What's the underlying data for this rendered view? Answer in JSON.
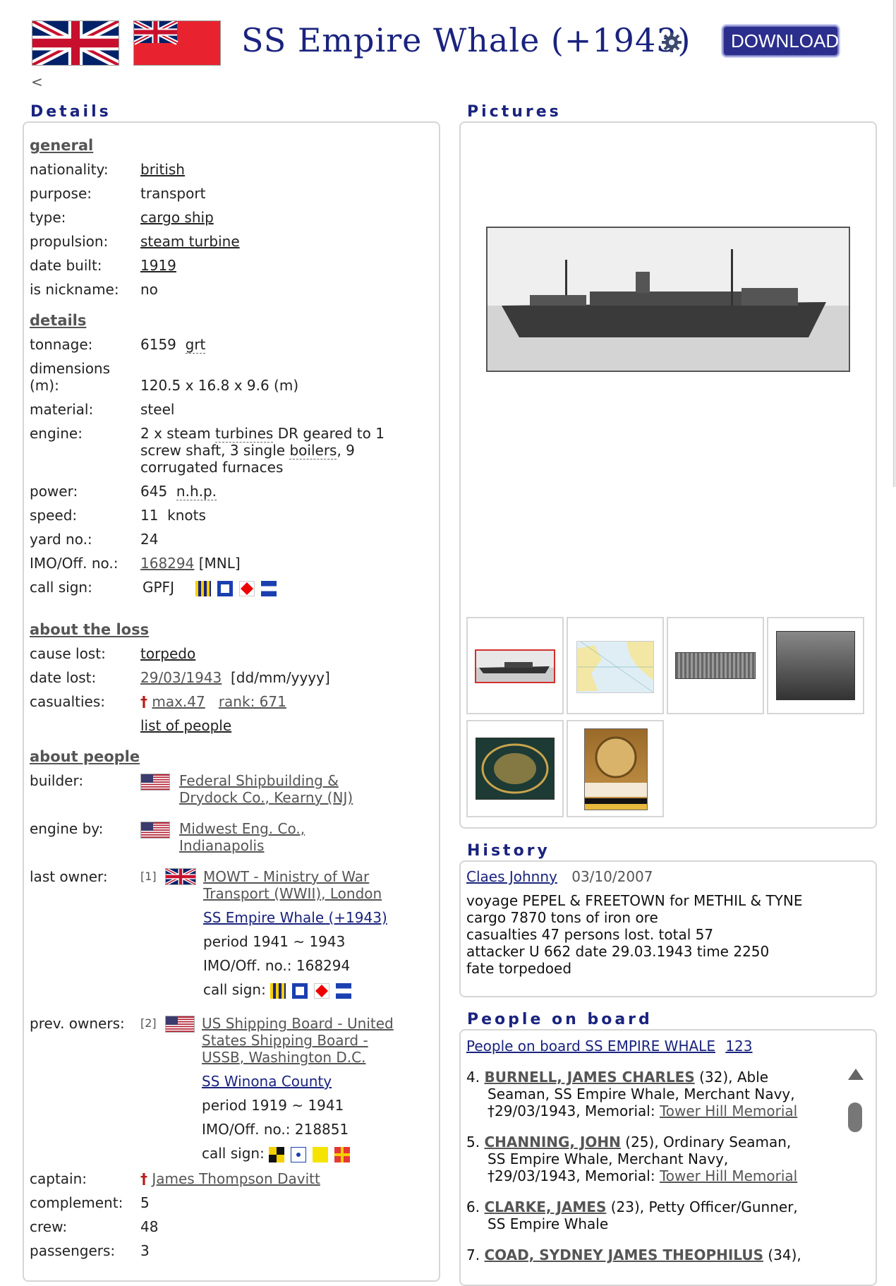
{
  "header": {
    "title": "SS Empire Whale (+1943)",
    "download_label": "DOWNLOAD",
    "back_label": "<"
  },
  "details": {
    "heading": "Details",
    "general": {
      "heading": "general",
      "nationality_label": "nationality:",
      "nationality": "british",
      "purpose_label": "purpose:",
      "purpose": "transport",
      "type_label": "type:",
      "type": "cargo ship",
      "propulsion_label": "propulsion:",
      "propulsion": "steam turbine",
      "date_built_label": "date built:",
      "date_built": "1919",
      "nickname_label": "is nickname:",
      "nickname": "no"
    },
    "specs": {
      "heading": "details",
      "tonnage_label": "tonnage:",
      "tonnage": "6159",
      "tonnage_unit": "grt",
      "dimensions_label_1": "dimensions",
      "dimensions_label_2": "(m):",
      "dimensions": "120.5 x 16.8 x 9.6 (m)",
      "material_label": "material:",
      "material": "steel",
      "engine_label": "engine:",
      "engine_1a": "2 x steam ",
      "engine_1b": "turbines",
      "engine_1c": " DR geared to 1",
      "engine_2a": "screw shaft, 3 single ",
      "engine_2b": "boilers",
      "engine_2c": ", 9",
      "engine_3": "corrugated furnaces",
      "power_label": "power:",
      "power": "645",
      "power_unit": "n.h.p.",
      "speed_label": "speed:",
      "speed": "11",
      "speed_unit": "knots",
      "yard_label": "yard no.:",
      "yard": "24",
      "imo_label": "IMO/Off. no.:",
      "imo": "168294",
      "imo_suffix": "[MNL]",
      "callsign_label": "call sign:",
      "callsign": "GPFJ"
    },
    "loss": {
      "heading": "about the loss",
      "cause_label": "cause lost:",
      "cause": "torpedo",
      "date_label": "date lost:",
      "date_day": "29/03/",
      "date_year": "1943",
      "date_format": "[dd/mm/yyyy]",
      "casualties_label": "casualties:",
      "casualties_max": "max.47",
      "casualties_rank": "rank: 671",
      "people_list": "list of people"
    },
    "people": {
      "heading": "about people",
      "builder_label": "builder:",
      "builder_1": "Federal Shipbuilding &",
      "builder_2a": "Drydock Co.",
      "builder_2b": "Kearny (NJ)",
      "engine_by_label": "engine by:",
      "engine_by_1": "Midwest Eng. Co.,",
      "engine_by_2": "Indianapolis",
      "last_owner_label": "last owner:",
      "last_owner_count": "[1]",
      "last_owner_1": "MOWT - Ministry of War",
      "last_owner_2a": "Transport (WWII)",
      "last_owner_2b": "London",
      "last_owner_ship": "SS Empire Whale (+1943)",
      "last_owner_period": "period 1941 ~ 1943",
      "last_owner_imo": "IMO/Off. no.: 168294",
      "last_owner_callsign": "call sign:",
      "prev_owners_label": "prev. owners:",
      "prev_owners_count": "[2]",
      "prev_owner_1": "US Shipping Board - United",
      "prev_owner_2": "States Shipping Board -",
      "prev_owner_3a": "USSB",
      "prev_owner_3b": "Washington D.C.",
      "prev_owner_ship": "SS Winona County",
      "prev_owner_period": "period 1919 ~ 1941",
      "prev_owner_imo": "IMO/Off. no.: 218851",
      "prev_owner_callsign": "call sign:",
      "captain_label": "captain:",
      "captain": "James Thompson Davitt",
      "complement_label": "complement:",
      "complement": "5",
      "crew_label": "crew:",
      "crew": "48",
      "passengers_label": "passengers:",
      "passengers": "3"
    }
  },
  "pictures": {
    "heading": "Pictures"
  },
  "history": {
    "heading": "History",
    "author": "Claes Johnny",
    "date": "03/10/2007",
    "lines": [
      "voyage PEPEL & FREETOWN for METHIL & TYNE",
      "cargo 7870 tons of iron ore",
      "casualties 47 persons lost. total 57",
      "attacker U 662 date 29.03.1943 time 2250",
      "fate torpedoed"
    ]
  },
  "people_on_board": {
    "heading": "People on board",
    "link": "People on board SS EMPIRE WHALE",
    "count": "123",
    "items": [
      {
        "num": "4.",
        "name": "BURNELL, JAMES CHARLES",
        "rest1": " (32), Able",
        "rest2": "Seaman, SS Empire Whale, Merchant Navy,",
        "rest3": "†29/03/1943, Memorial: ",
        "memorial": "Tower Hill Memorial"
      },
      {
        "num": "5.",
        "name": "CHANNING, JOHN",
        "rest1": " (25), Ordinary Seaman,",
        "rest2": "SS Empire Whale, Merchant Navy,",
        "rest3": "†29/03/1943, Memorial: ",
        "memorial": "Tower Hill Memorial"
      },
      {
        "num": "6.",
        "name": "CLARKE, JAMES",
        "rest1": " (23), Petty Officer/Gunner,",
        "rest2": "SS Empire Whale"
      },
      {
        "num": "7.",
        "name": "COAD, SYDNEY JAMES THEOPHILUS",
        "rest1": " (34),"
      }
    ]
  },
  "colors": {
    "accent": "#1a237e",
    "button": "#2b2e8c",
    "cross": "#b71c1c"
  }
}
